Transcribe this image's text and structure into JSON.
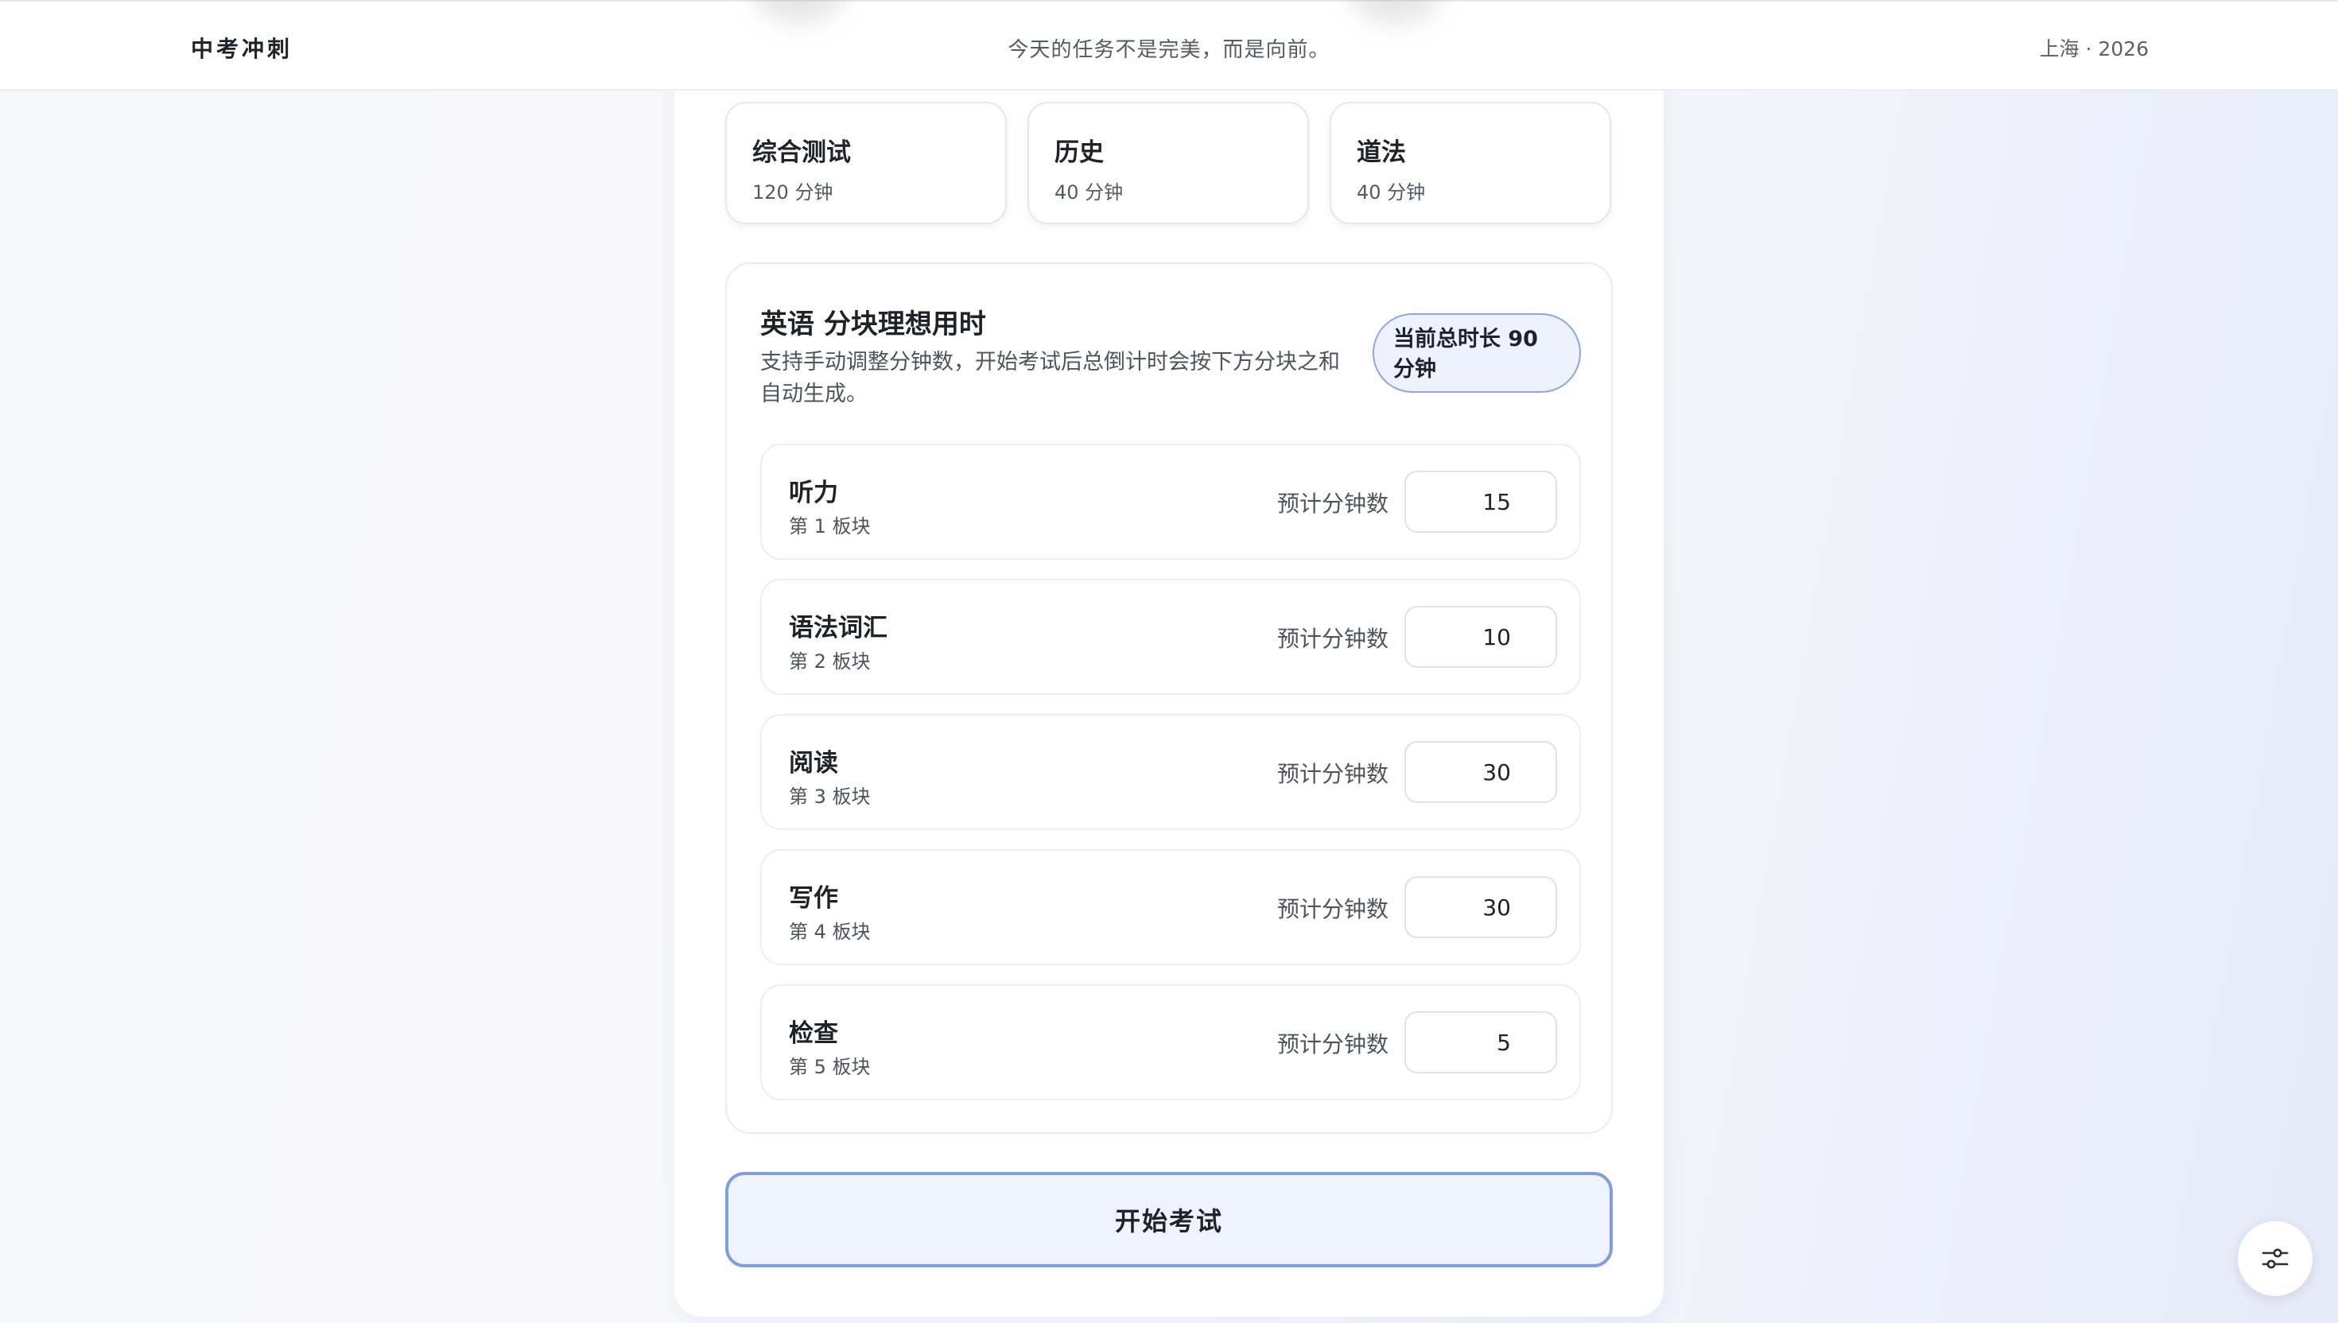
{
  "header": {
    "brand": "中考冲刺",
    "motto": "今天的任务不是完美，而是向前。",
    "location": "上海 · 2026"
  },
  "subjects": [
    {
      "name": "综合测试",
      "duration": "120 分钟"
    },
    {
      "name": "历史",
      "duration": "40 分钟"
    },
    {
      "name": "道法",
      "duration": "40 分钟"
    }
  ],
  "config": {
    "title": "英语 分块理想用时",
    "description": "支持手动调整分钟数，开始考试后总倒计时会按下方分块之和自动生成。",
    "total_badge": "当前总时长 90 分钟",
    "input_label": "预计分钟数",
    "segments": [
      {
        "name": "听力",
        "order": "第 1 板块",
        "minutes": "15"
      },
      {
        "name": "语法词汇",
        "order": "第 2 板块",
        "minutes": "10"
      },
      {
        "name": "阅读",
        "order": "第 3 板块",
        "minutes": "30"
      },
      {
        "name": "写作",
        "order": "第 4 板块",
        "minutes": "30"
      },
      {
        "name": "检查",
        "order": "第 5 板块",
        "minutes": "5"
      }
    ]
  },
  "actions": {
    "start_label": "开始考试"
  },
  "icons": {
    "fab": "sliders-icon"
  },
  "colors": {
    "accent_border": "#7f9ce6",
    "accent_fill": "#eef3fd"
  }
}
